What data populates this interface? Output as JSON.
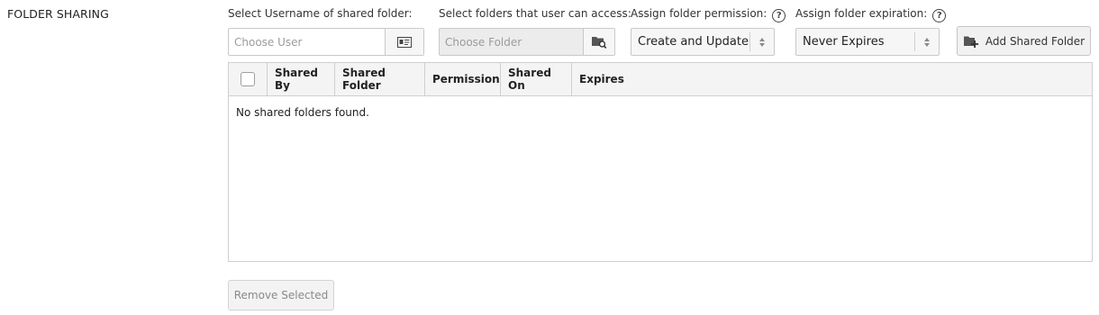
{
  "section": {
    "title": "FOLDER SHARING"
  },
  "user_picker": {
    "label": "Select Username of shared folder:",
    "placeholder": "Choose User",
    "button_icon": "contact-card-icon"
  },
  "folder_picker": {
    "label": "Select folders that user can access:",
    "placeholder": "Choose Folder",
    "button_icon": "folder-search-icon"
  },
  "permission": {
    "label": "Assign folder permission:",
    "help_icon": "question-circle-icon",
    "help_glyph": "?",
    "selected": "Create and Update"
  },
  "expiration": {
    "label": "Assign folder expiration:",
    "help_icon": "question-circle-icon",
    "help_glyph": "?",
    "selected": "Never Expires"
  },
  "add_button": {
    "label": "Add Shared Folder",
    "icon": "folder-plus-icon"
  },
  "table": {
    "columns": [
      "Shared By",
      "Shared Folder",
      "Permission",
      "Shared On",
      "Expires"
    ],
    "empty_message": "No shared folders found."
  },
  "remove_button": {
    "label": "Remove Selected"
  }
}
